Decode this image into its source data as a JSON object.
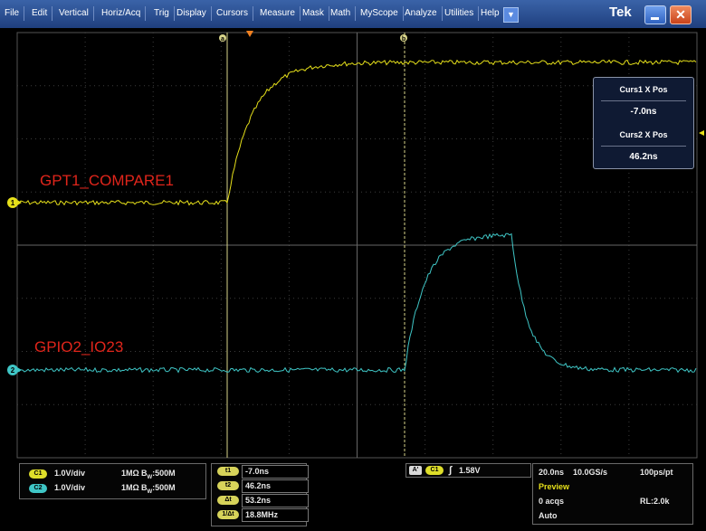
{
  "menu": {
    "items": [
      "File",
      "Edit",
      "Vertical",
      "Horiz/Acq",
      "Trig",
      "Display",
      "Cursors",
      "Measure",
      "Mask",
      "Math",
      "MyScope",
      "Analyze",
      "Utilities",
      "Help"
    ],
    "dropdown_icon": "triangle-down-icon",
    "brand": "Tek"
  },
  "colors": {
    "ch1": "#e6e01a",
    "ch2": "#3fc6c6",
    "label": "#e0251b",
    "grid": "#3c3c3c"
  },
  "channels": {
    "ch1": {
      "label": "GPT1_COMPARE1",
      "marker": "1"
    },
    "ch2": {
      "label": "GPIO2_IO23",
      "marker": "2"
    }
  },
  "cursor_markers": {
    "a": "a",
    "b": "b"
  },
  "cursor_readout": {
    "curs1_title": "Curs1 X Pos",
    "curs1_value": "-7.0ns",
    "curs2_title": "Curs2 X Pos",
    "curs2_value": "46.2ns"
  },
  "status": {
    "ch1": {
      "chip": "C1",
      "scale": "1.0V/div",
      "impedance": "1MΩ",
      "bw": "B",
      "bw_sub": "W",
      "bw_value": ":500M"
    },
    "ch2": {
      "chip": "C2",
      "scale": "1.0V/div",
      "impedance": "1MΩ",
      "bw": "B",
      "bw_sub": "W",
      "bw_value": ":500M"
    },
    "cursors": [
      {
        "chip": "t1",
        "value": "-7.0ns"
      },
      {
        "chip": "t2",
        "value": "46.2ns"
      },
      {
        "chip": "Δt",
        "value": "53.2ns"
      },
      {
        "chip": "1/Δt",
        "value": "18.8MHz"
      }
    ],
    "trigger": {
      "mode": "A'",
      "source": "C1",
      "slope": "∫",
      "level": "1.58V"
    },
    "acq": {
      "timebase": "20.0ns",
      "sample_rate": "10.0GS/s",
      "points": "100ps/pt",
      "mode": "Preview",
      "acqs": "0 acqs",
      "record": "RL:2.0k",
      "run": "Auto"
    }
  }
}
